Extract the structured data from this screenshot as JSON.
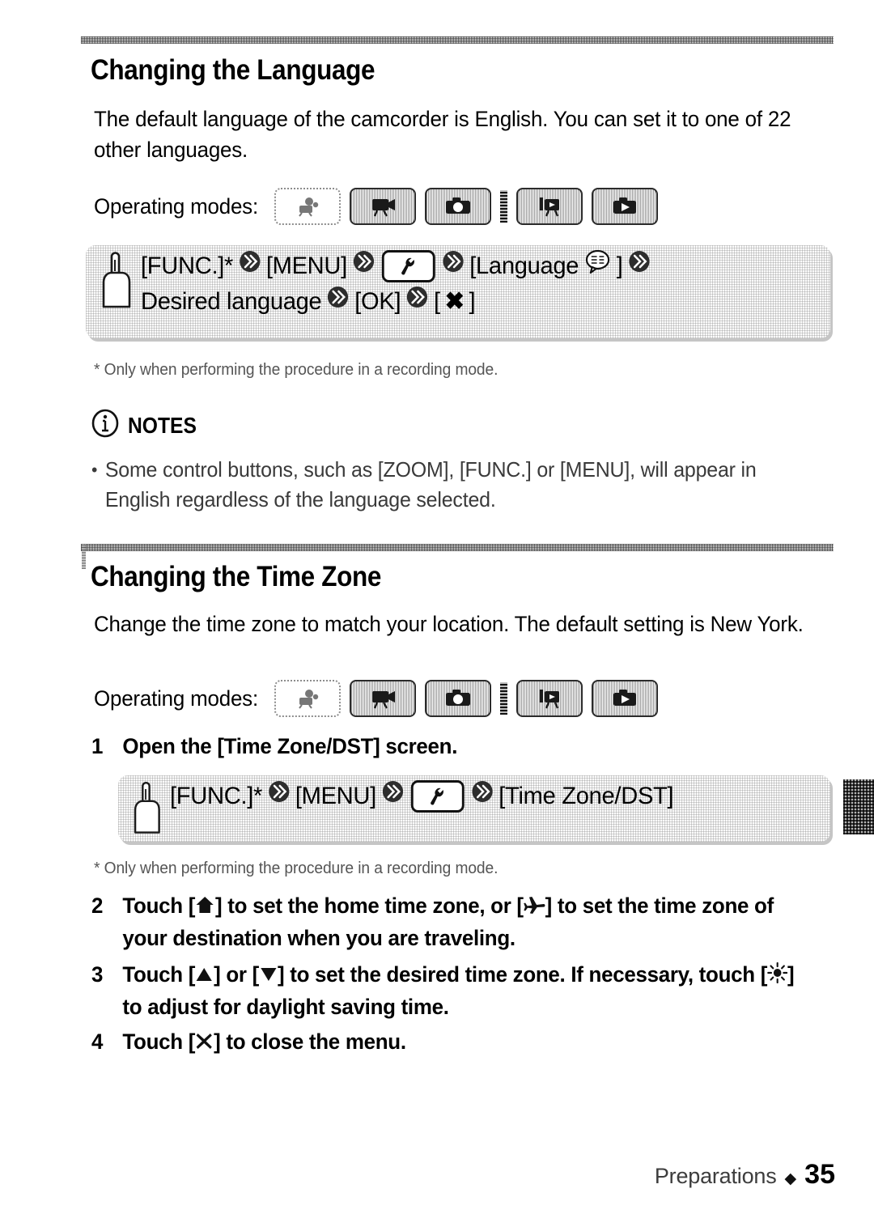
{
  "sections": {
    "language": {
      "heading": "Changing the Language",
      "paragraph": "The default language of the camcorder is English. You can set it to one of 22 other languages.",
      "operating_modes_label": "Operating modes:",
      "procedure": {
        "line1_a": "[FUNC.]*",
        "line1_b": "[MENU]",
        "line1_c": "[Language",
        "line1_d": "]",
        "line2_a": "Desired language",
        "line2_b": "[OK]",
        "line2_c": "[",
        "line2_d": "]"
      },
      "footnote": "* Only when performing the procedure in a recording mode."
    },
    "notes": {
      "title": "NOTES",
      "bullet_marker": "•",
      "body": "Some control buttons, such as [ZOOM], [FUNC.] or [MENU], will appear in English regardless of the language selected."
    },
    "timezone": {
      "heading": "Changing the Time Zone",
      "paragraph": "Change the time zone to match your location. The default setting is New York.",
      "operating_modes_label": "Operating modes:",
      "steps": [
        {
          "num": "1",
          "text": "Open the [Time Zone/DST] screen."
        },
        {
          "num": "2",
          "text_a": "Touch [",
          "text_b": "] to set the home time zone, or [",
          "text_c": "] to set the time zone of your destination when you are traveling."
        },
        {
          "num": "3",
          "text_a": "Touch [",
          "text_b": "] or [",
          "text_c": "] to set the desired time zone. If necessary, touch [",
          "text_d": "] to adjust for daylight saving time."
        },
        {
          "num": "4",
          "text_a": "Touch [",
          "text_b": "] to close the menu."
        }
      ],
      "procedure": {
        "line1_a": "[FUNC.]*",
        "line1_b": "[MENU]",
        "line1_c": "[Time Zone/DST]"
      },
      "footnote": "* Only when performing the procedure in a recording mode."
    }
  },
  "operating_modes": [
    {
      "name": "dual-shot-mode",
      "state": "off"
    },
    {
      "name": "movie-record-mode",
      "state": "on"
    },
    {
      "name": "photo-record-mode",
      "state": "on"
    },
    {
      "name": "mode-separator",
      "state": "sep"
    },
    {
      "name": "movie-playback-mode",
      "state": "on"
    },
    {
      "name": "photo-playback-mode",
      "state": "on"
    }
  ],
  "icons": {
    "hand_pointer": "hand-pointer-icon",
    "arrow_next": "double-chevron-icon",
    "tool_menu": "wrench-icon",
    "language_bubble": "speech-bubble-icon",
    "close_x": "✖",
    "home": "home-icon",
    "airplane": "airplane-icon",
    "up_triangle": "▲",
    "down_triangle": "▼",
    "sun_dst": "sun-icon",
    "info": "i"
  },
  "footer": {
    "label": "Preparations",
    "diamond": "◆",
    "page": "35"
  },
  "colors": {
    "ink": "#000000",
    "paper": "#ffffff",
    "screen_gray": "#9a9a9a",
    "muted_text": "#3a3a3a"
  }
}
